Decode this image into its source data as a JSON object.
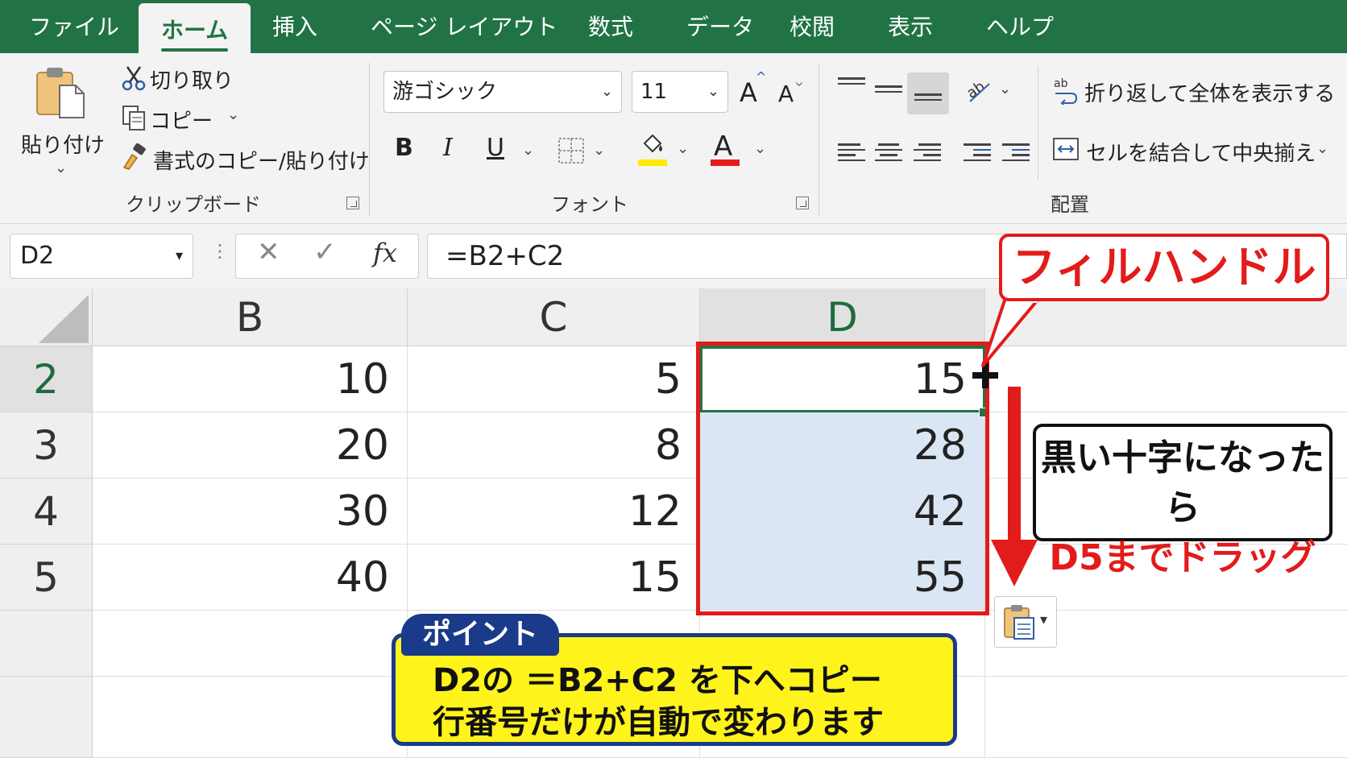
{
  "tabs": [
    "ファイル",
    "ホーム",
    "挿入",
    "ページ レイアウト",
    "数式",
    "データ",
    "校閲",
    "表示",
    "ヘルプ"
  ],
  "active_tab": "ホーム",
  "clipboard": {
    "paste_label": "貼り付け",
    "cut_label": "切り取り",
    "copy_label": "コピー",
    "format_painter_label": "書式のコピー/貼り付け",
    "group_label": "クリップボード"
  },
  "font": {
    "font_name": "游ゴシック",
    "font_size": "11",
    "bold": "B",
    "italic": "I",
    "underline": "U",
    "font_color_glyph": "A",
    "increase_size_glyph": "A",
    "decrease_size_glyph": "A",
    "group_label": "フォント",
    "fill_color": "#ffeb00",
    "font_color": "#e21b1b"
  },
  "alignment": {
    "wrap_text_label": "折り返して全体を表示する",
    "merge_label": "セルを結合して中央揃え",
    "group_label": "配置"
  },
  "formula_bar": {
    "name_box": "D2",
    "fx_label": "fx",
    "formula": "=B2+C2"
  },
  "sheet": {
    "columns": [
      "B",
      "C",
      "D"
    ],
    "selected_column": "D",
    "rows": [
      {
        "row": "2",
        "B": "10",
        "C": "5",
        "D": "15"
      },
      {
        "row": "3",
        "B": "20",
        "C": "8",
        "D": "28"
      },
      {
        "row": "4",
        "B": "30",
        "C": "12",
        "D": "42"
      },
      {
        "row": "5",
        "B": "40",
        "C": "15",
        "D": "55"
      }
    ]
  },
  "annotations": {
    "fill_handle_label": "フィルハンドル",
    "drag_line1": "黒い十字になったら",
    "drag_line2": "D5までドラッグ",
    "point_tag": "ポイント",
    "point_line1": "D2の ＝B2+C2 を下へコピー",
    "point_line2": "行番号だけが自動で変わります"
  },
  "colors": {
    "excel_green": "#217346",
    "highlight_red": "#e21b1b",
    "selection_fill": "#dbe6f4",
    "point_yellow": "#fff31c",
    "point_navy": "#1a3a8a"
  }
}
